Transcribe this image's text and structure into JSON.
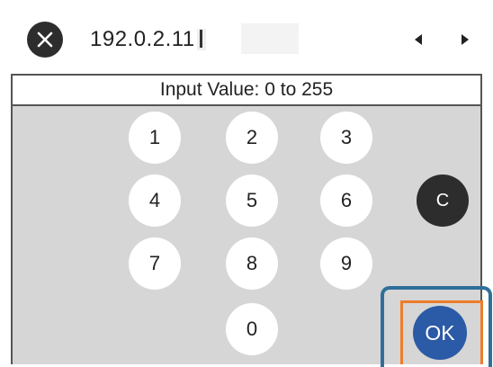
{
  "header": {
    "ip_value": "192.0.2.11",
    "close_icon": "close-icon",
    "left_arrow_icon": "triangle-left-icon",
    "right_arrow_icon": "triangle-right-icon"
  },
  "hint": "Input Value: 0 to 255",
  "keypad": {
    "keys": [
      "1",
      "2",
      "3",
      "4",
      "5",
      "6",
      "7",
      "8",
      "9",
      "0"
    ],
    "clear_label": "C",
    "ok_label": "OK"
  },
  "colors": {
    "keypad_background": "#d6d6d6",
    "dark_button": "#2d2d2d",
    "ok_button": "#2b5aa6",
    "highlight_blue": "#2f6f9a",
    "highlight_orange": "#ee7d2b"
  }
}
